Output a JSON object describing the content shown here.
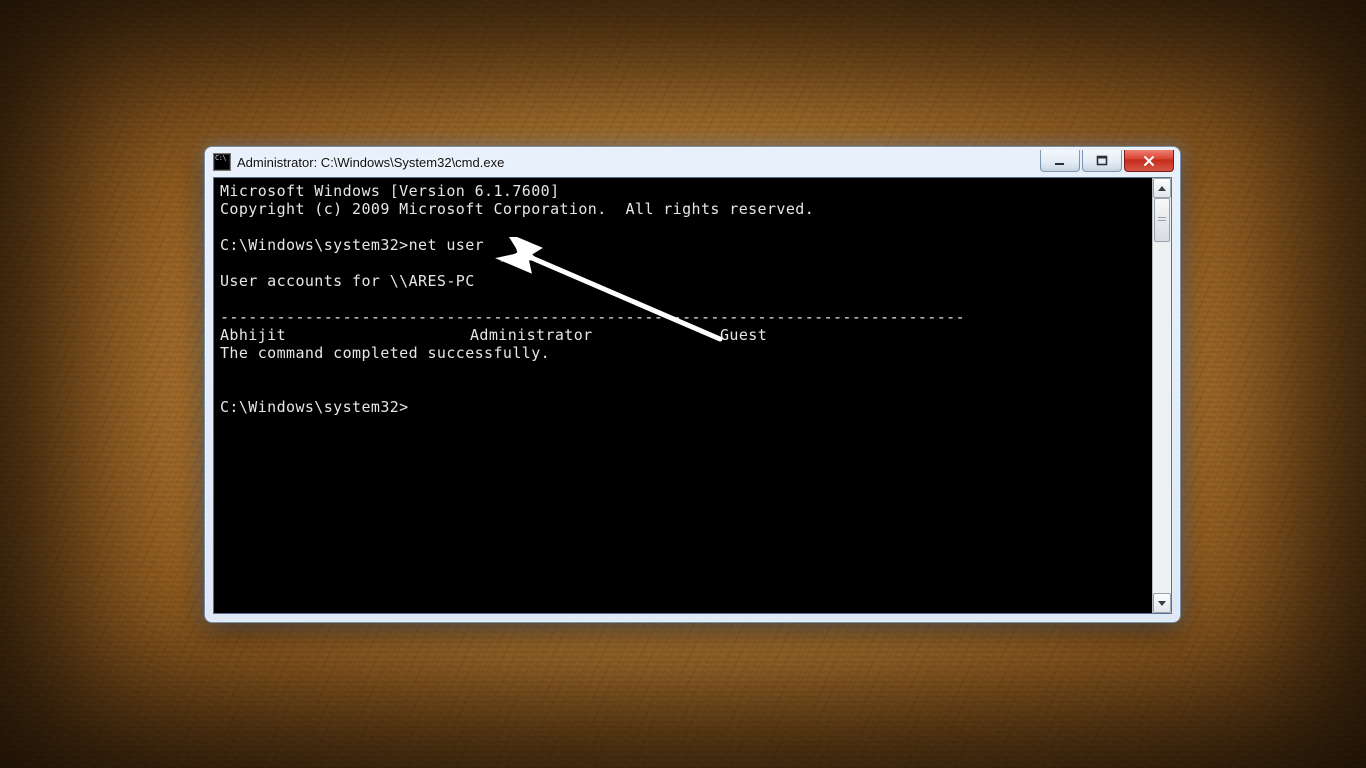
{
  "window": {
    "title": "Administrator: C:\\Windows\\System32\\cmd.exe"
  },
  "terminal": {
    "banner_line1": "Microsoft Windows [Version 6.1.7600]",
    "banner_line2": "Copyright (c) 2009 Microsoft Corporation.  All rights reserved.",
    "prompt1": "C:\\Windows\\system32>",
    "command1": "net user",
    "output_header": "User accounts for \\\\ARES-PC",
    "separator": "-------------------------------------------------------------------------------",
    "users": [
      "Abhijit",
      "Administrator",
      "Guest"
    ],
    "output_status": "The command completed successfully.",
    "prompt2": "C:\\Windows\\system32>"
  },
  "icons": {
    "app": "cmd-icon",
    "minimize": "minimize-icon",
    "maximize": "maximize-icon",
    "close": "close-icon",
    "scroll_up": "scroll-up-icon",
    "scroll_down": "scroll-down-icon"
  }
}
